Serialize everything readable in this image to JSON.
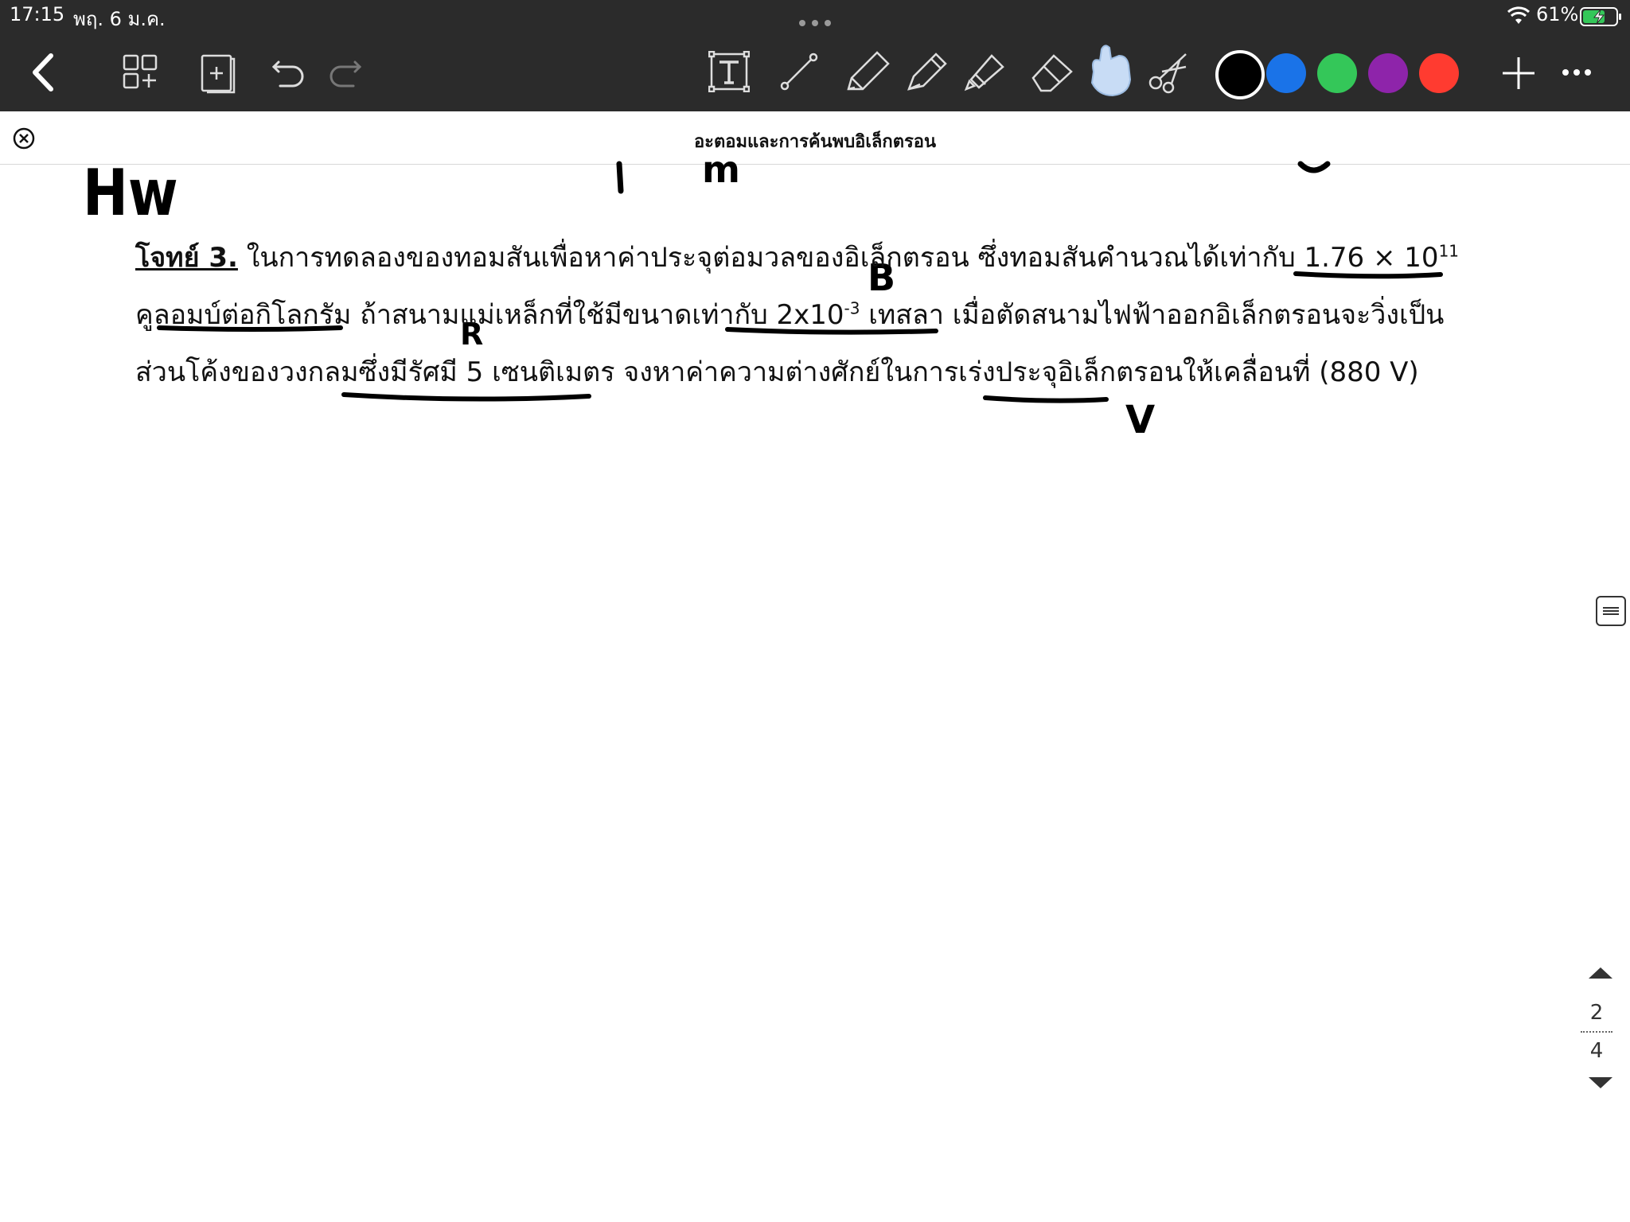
{
  "status_bar": {
    "time": "17:15",
    "date": "พฤ. 6 ม.ค.",
    "battery": "61%"
  },
  "toolbar": {
    "icons": [
      "back-icon",
      "add-page-grid-icon",
      "add-page-icon",
      "undo-icon",
      "redo-icon",
      "text-tool-icon",
      "line-tool-icon",
      "pencil-icon",
      "pen-icon",
      "highlighter-icon",
      "eraser-icon",
      "lasso-hand-icon",
      "scissors-icon",
      "plus-icon",
      "more-icon"
    ],
    "colors": [
      "#000000",
      "#1a73e8",
      "#34c759",
      "#8e24aa",
      "#ff3b30"
    ],
    "selected_color": "#000000"
  },
  "document": {
    "title": "อะตอมและการค้นพบอิเล็กตรอน",
    "line1": {
      "label": "โจทย์ 3.",
      "text": " ในการทดลองของทอมสันเพื่อหาค่าประจุต่อมวลของอิเล็กตรอน  ซึ่งทอมสันคำนวณได้เท่ากับ ",
      "value": "1.76 × 10",
      "exp": "11"
    },
    "line2": {
      "text_a": "คูลอมบ์ต่อกิโลกรัม  ถ้าสนามแม่เหล็กที่ใช้มีขนาดเท่ากับ 2x10",
      "exp": "-3",
      "text_b": " เทสลา    เมื่อตัดสนามไฟฟ้าออกอิเล็กตรอนจะวิ่งเป็น"
    },
    "line3": {
      "text": "ส่วนโค้งของวงกลมซึ่งมีรัศมี 5 เซนติเมตร   จงหาค่าความต่างศักย์ในการเร่งประจุอิเล็กตรอนให้เคลื่อนที่ (880 V)"
    }
  },
  "handwriting": {
    "hw": "Hw",
    "m": "m",
    "b": "B",
    "r": "R",
    "v": "V"
  },
  "page_nav": {
    "current": "2",
    "total": "4"
  }
}
